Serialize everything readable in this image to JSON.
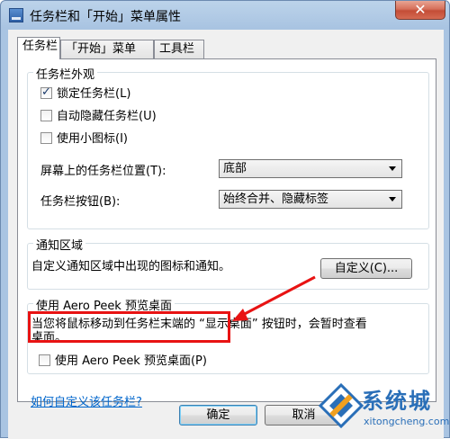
{
  "window": {
    "title": "任务栏和「开始」菜单属性",
    "close_symbol": "✕"
  },
  "tabs": [
    {
      "label": "任务栏"
    },
    {
      "label": "「开始」菜单"
    },
    {
      "label": "工具栏"
    }
  ],
  "appearance": {
    "title": "任务栏外观",
    "lock": {
      "label": "锁定任务栏(L)",
      "checked": true
    },
    "autohide": {
      "label": "自动隐藏任务栏(U)",
      "checked": false
    },
    "small_icons": {
      "label": "使用小图标(I)",
      "checked": false
    },
    "position_label": "屏幕上的任务栏位置(T):",
    "position_value": "底部",
    "buttons_label": "任务栏按钮(B):",
    "buttons_value": "始终合并、隐藏标签"
  },
  "notification": {
    "title": "通知区域",
    "description": "自定义通知区域中出现的图标和通知。",
    "customize_button": "自定义(C)..."
  },
  "aero_peek": {
    "title": "使用 Aero Peek 预览桌面",
    "description_line1": "当您将鼠标移动到任务栏末端的 “显示桌面” 按钮时，会暂时查看",
    "description_line2": "桌面。",
    "checkbox_label": "使用 Aero Peek 预览桌面(P)",
    "checked": false
  },
  "help_link": "如何自定义该任务栏?",
  "footer": {
    "ok_button": "确定",
    "cancel_button": "取消"
  },
  "watermark": {
    "brand": "系统城",
    "url": "xitongcheng.com"
  },
  "colors": {
    "highlight": "#e81313",
    "link": "#0066cc"
  }
}
